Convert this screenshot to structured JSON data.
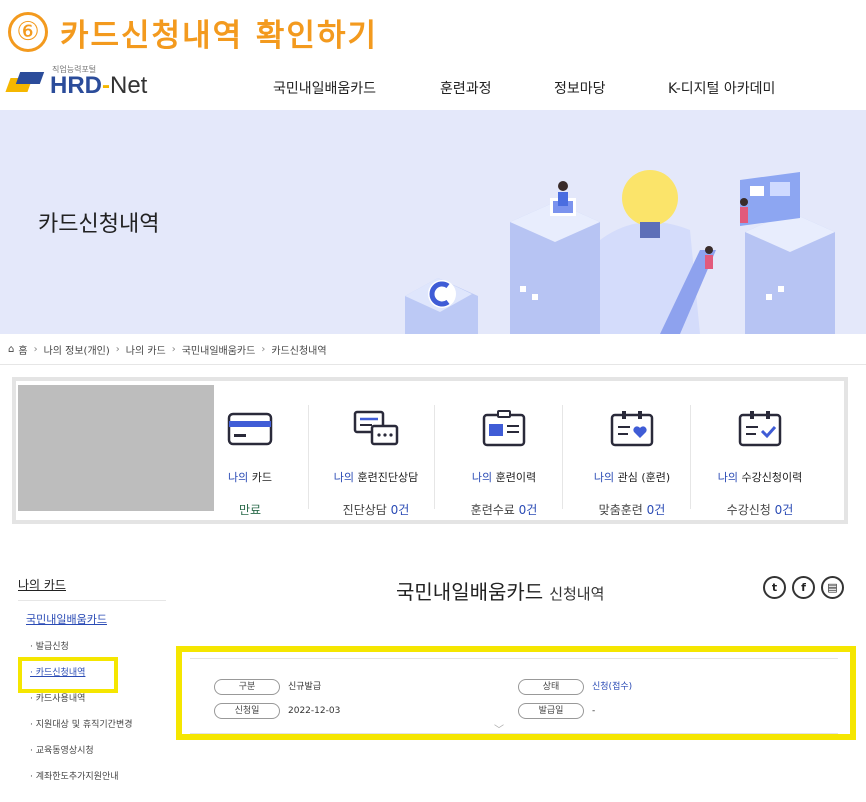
{
  "step": {
    "number": "⑥",
    "title": "카드신청내역 확인하기"
  },
  "header": {
    "logo_sub": "직업능력포털",
    "logo_hrd": "HRD",
    "logo_dash": "-",
    "logo_net": "Net",
    "nav": [
      "국민내일배움카드",
      "훈련과정",
      "정보마당",
      "K-디지털 아카데미"
    ]
  },
  "banner": {
    "title": "카드신청내역"
  },
  "breadcrumb": [
    "홈",
    "나의 정보(개인)",
    "나의 카드",
    "국민내일배움카드",
    "카드신청내역"
  ],
  "summary": {
    "items": [
      {
        "icon": "card-icon",
        "label_hl": "나의",
        "label_rest": " 카드",
        "value_text": "만료",
        "value_num": ""
      },
      {
        "icon": "chat-consult-icon",
        "label_hl": "나의",
        "label_rest": " 훈련진단상담",
        "value_text": "진단상담 ",
        "value_num": "0건"
      },
      {
        "icon": "id-card-icon",
        "label_hl": "나의",
        "label_rest": " 훈련이력",
        "value_text": "훈련수료 ",
        "value_num": "0건"
      },
      {
        "icon": "heart-board-icon",
        "label_hl": "나의",
        "label_rest": " 관심 (훈련)",
        "value_text": "맞춤훈련 ",
        "value_num": "0건"
      },
      {
        "icon": "check-board-icon",
        "label_hl": "나의",
        "label_rest": " 수강신청이력",
        "value_text": "수강신청 ",
        "value_num": "0건"
      }
    ]
  },
  "left_menu": {
    "title": "나의 카드",
    "sub": "국민내일배움카드",
    "items": [
      "· 발급신청",
      "· 카드신청내역",
      "· 카드사용내역",
      "· 지원대상 및 휴직기간변경",
      "· 교육동영상시청",
      "· 계좌한도추가지원안내"
    ]
  },
  "content": {
    "title_main": "국민내일배움카드",
    "title_sub": "신청내역",
    "share": {
      "twitter": "t",
      "facebook": "f",
      "print": "▤"
    },
    "detail": {
      "type_label": "구분",
      "type_value": "신규발급",
      "status_label": "상태",
      "status_value": "신청(접수)",
      "date_label": "신청일",
      "date_value": "2022-12-03",
      "issue_label": "발급일",
      "issue_value": "-"
    }
  }
}
